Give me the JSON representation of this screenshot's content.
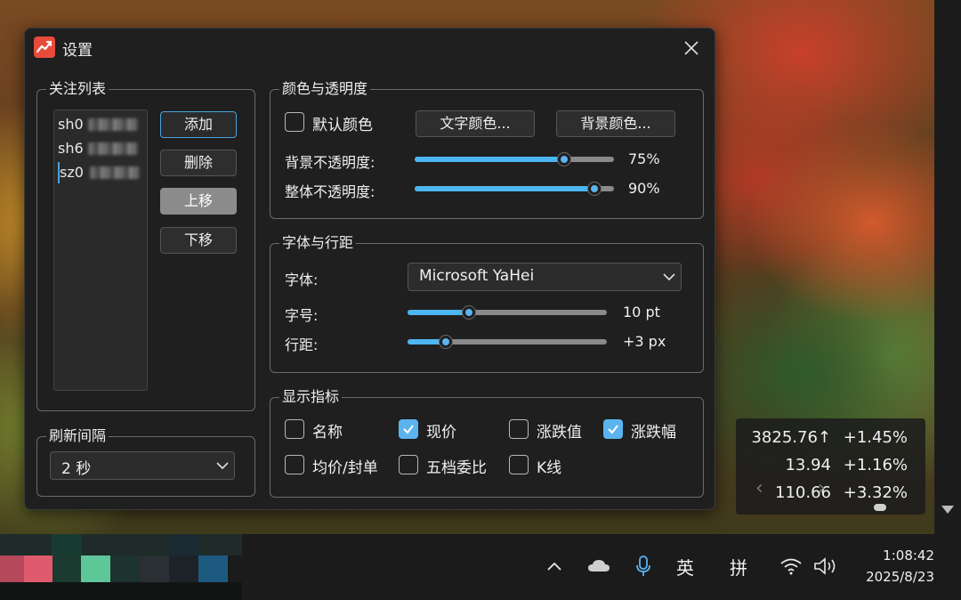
{
  "dialog": {
    "title": "设置",
    "close_symbol": "✕"
  },
  "watchlist": {
    "legend": "关注列表",
    "items": [
      {
        "code": "sh0"
      },
      {
        "code": "sh6"
      },
      {
        "code": "sz0"
      }
    ],
    "buttons": {
      "add": "添加",
      "delete": "删除",
      "move_up": "上移",
      "move_down": "下移"
    }
  },
  "refresh": {
    "legend": "刷新间隔",
    "value": "2 秒"
  },
  "color_opacity": {
    "legend": "颜色与透明度",
    "default_color_label": "默认颜色",
    "default_color_checked": false,
    "text_color_button": "文字颜色...",
    "bg_color_button": "背景颜色...",
    "bg_opacity_label": "背景不透明度:",
    "bg_opacity_value": "75%",
    "bg_opacity": 75,
    "overall_opacity_label": "整体不透明度:",
    "overall_opacity_value": "90%",
    "overall_opacity": 90
  },
  "font_spacing": {
    "legend": "字体与行距",
    "font_label": "字体:",
    "font_value": "Microsoft YaHei",
    "size_label": "字号:",
    "size_value": "10 pt",
    "size_fraction": 0.31,
    "spacing_label": "行距:",
    "spacing_value": "+3 px",
    "spacing_fraction": 0.19
  },
  "indicators": {
    "legend": "显示指标",
    "items": [
      {
        "label": "名称",
        "checked": false
      },
      {
        "label": "现价",
        "checked": true
      },
      {
        "label": "涨跌值",
        "checked": false
      },
      {
        "label": "涨跌幅",
        "checked": true
      },
      {
        "label": "均价/封单",
        "checked": false
      },
      {
        "label": "五档委比",
        "checked": false
      },
      {
        "label": "K线",
        "checked": false
      }
    ]
  },
  "stock_widget": {
    "rows": [
      {
        "price": "3825.76↑",
        "change": "+1.45%"
      },
      {
        "price": "13.94",
        "change": "+1.16%"
      },
      {
        "price": "110.66",
        "change": "+3.32%"
      }
    ],
    "prev_symbol": "‹",
    "next_symbol": "›"
  },
  "taskbar": {
    "ime_lang": "英",
    "ime_mode": "拼",
    "time": "1:08:42",
    "date": "2025/8/23"
  },
  "colors": {
    "accent": "#5bb4f0",
    "dialog_bg": "#1f1f1f",
    "app_icon": "#e74b3c"
  }
}
